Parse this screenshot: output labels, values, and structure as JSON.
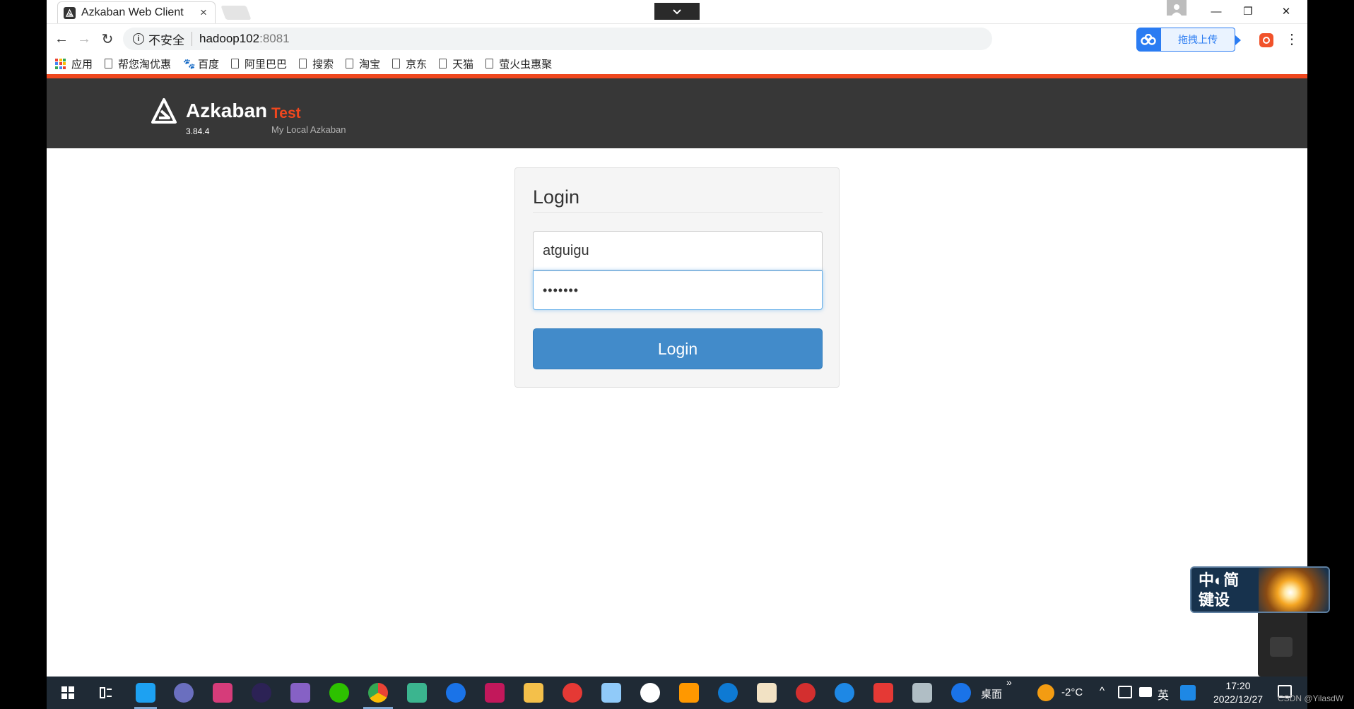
{
  "browser": {
    "tab_title": "Azkaban Web Client",
    "tab_close": "×",
    "window_controls": {
      "minimize": "—",
      "restore": "❐",
      "close": "✕"
    },
    "nav": {
      "back": "←",
      "forward": "→",
      "reload": "↻",
      "menu": "⋮"
    },
    "address": {
      "insecure_label": "不安全",
      "host": "hadoop102",
      "port": ":8081"
    },
    "extension_upload_label": "拖拽上传",
    "bookmarks": [
      {
        "label": "应用",
        "icon": "apps-grid-icon"
      },
      {
        "label": "帮您淘优惠",
        "icon": "page-icon"
      },
      {
        "label": "百度",
        "icon": "baidu-paw-icon"
      },
      {
        "label": "阿里巴巴",
        "icon": "page-icon"
      },
      {
        "label": "搜索",
        "icon": "page-icon"
      },
      {
        "label": "淘宝",
        "icon": "page-icon"
      },
      {
        "label": "京东",
        "icon": "page-icon"
      },
      {
        "label": "天猫",
        "icon": "page-icon"
      },
      {
        "label": "萤火虫惠聚",
        "icon": "page-icon"
      }
    ]
  },
  "azkaban": {
    "brand": "Azkaban",
    "version": "3.84.4",
    "environment": "Test",
    "description": "My Local Azkaban",
    "accent_color": "#f0471e"
  },
  "login": {
    "title": "Login",
    "username_value": "atguigu",
    "password_mask": "•••••••",
    "button_label": "Login",
    "button_color": "#428bca"
  },
  "ime_widget": {
    "line1": "中◐简",
    "line2": "键设"
  },
  "taskbar": {
    "desktop_label": "桌面",
    "weather": "-2°C",
    "input_lang": "英",
    "time": "17:20",
    "date": "2022/12/27"
  },
  "watermark": "CSDN @YilasdW"
}
